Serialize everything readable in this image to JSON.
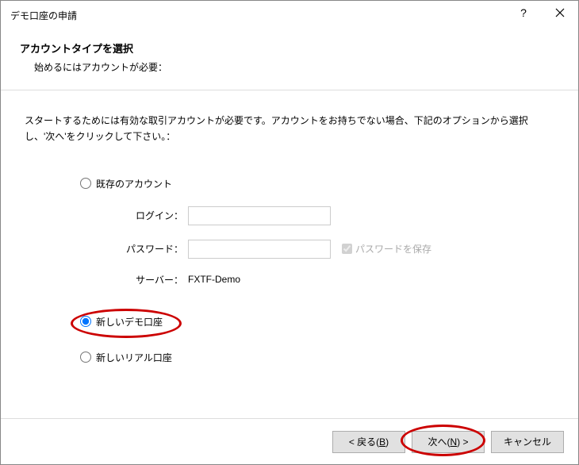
{
  "window": {
    "title": "デモ口座の申請"
  },
  "header": {
    "title": "アカウントタイプを選択",
    "subtitle": "始めるにはアカウントが必要："
  },
  "instruction": "スタートするためには有効な取引アカウントが必要です。アカウントをお持ちでない場合、下記のオプションから選択し、'次へ'をクリックして下さい。：",
  "options": {
    "existing": {
      "label": "既存のアカウント",
      "login_label": "ログイン：",
      "login_value": "",
      "password_label": "パスワード：",
      "password_value": "",
      "save_password_label": "パスワードを保存",
      "server_label": "サーバー：",
      "server_value": "FXTF-Demo"
    },
    "new_demo": {
      "label": "新しいデモ口座"
    },
    "new_real": {
      "label": "新しいリアル口座"
    }
  },
  "buttons": {
    "back": "< 戻る(B)",
    "next": "次へ(N) >",
    "cancel": "キャンセル"
  }
}
